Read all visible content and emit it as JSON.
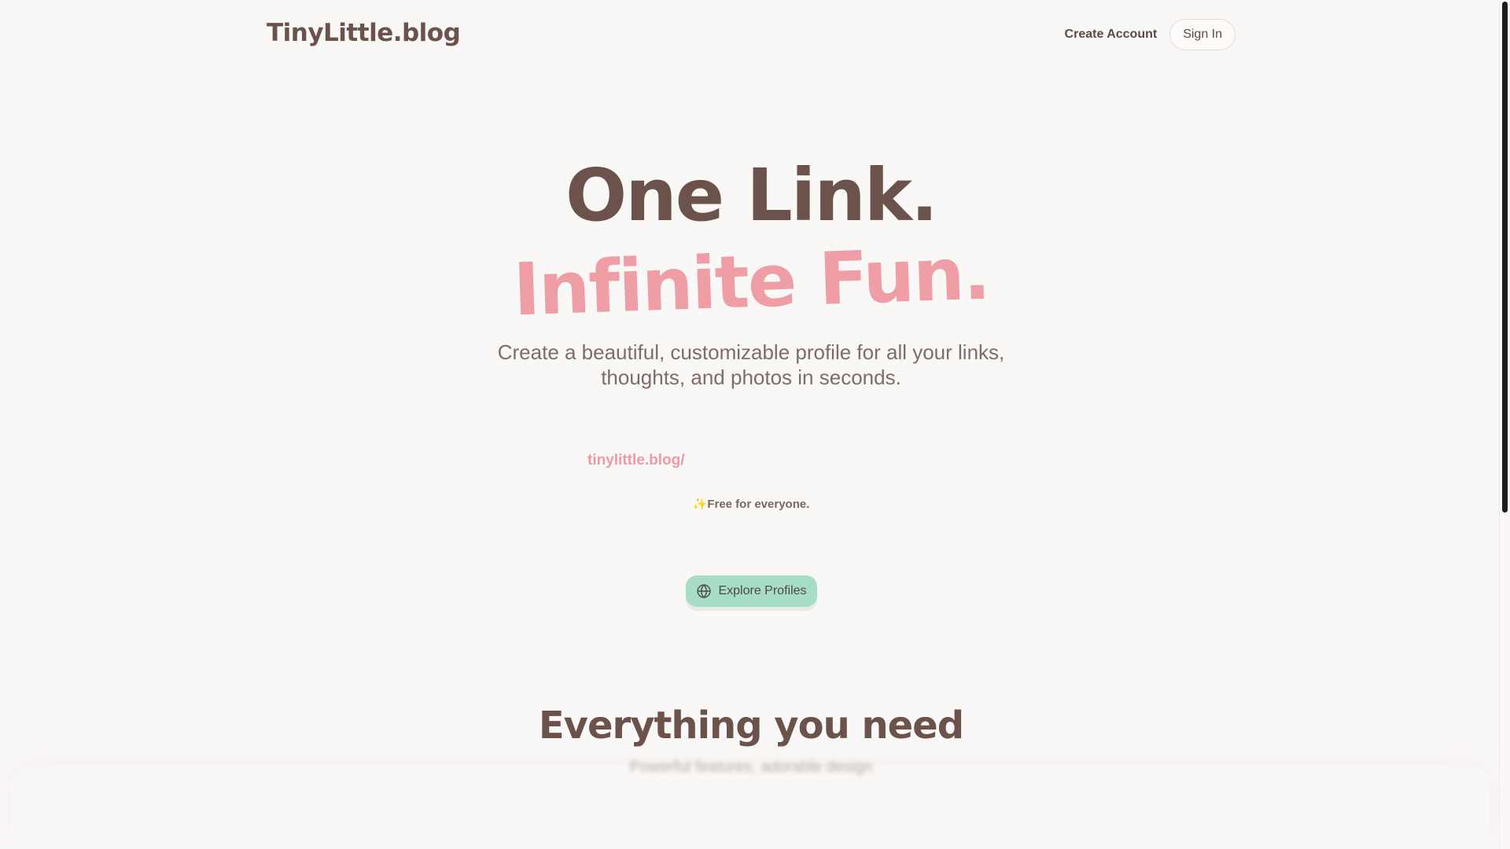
{
  "header": {
    "logo": "TinyLittle.blog",
    "create_account": "Create Account",
    "sign_in": "Sign In"
  },
  "hero": {
    "line1": "One Link.",
    "line2": "Infinite Fun.",
    "subtitle_line1": "Create a beautiful, customizable profile for all your links,",
    "subtitle_line2": "thoughts, and photos in seconds."
  },
  "claim": {
    "url_prefix": "tinylittle.blog/",
    "sparkle": "✨",
    "free_note": "Free for everyone."
  },
  "explore": {
    "label": "Explore Profiles",
    "icon": "globe-icon"
  },
  "features": {
    "title": "Everything you need",
    "subtitle": "Powerful features, adorable design"
  },
  "colors": {
    "brand_brown": "#6b534b",
    "accent_pink": "#ef9ea6",
    "mint": "#a7dcc6",
    "background": "#faf8f7"
  }
}
